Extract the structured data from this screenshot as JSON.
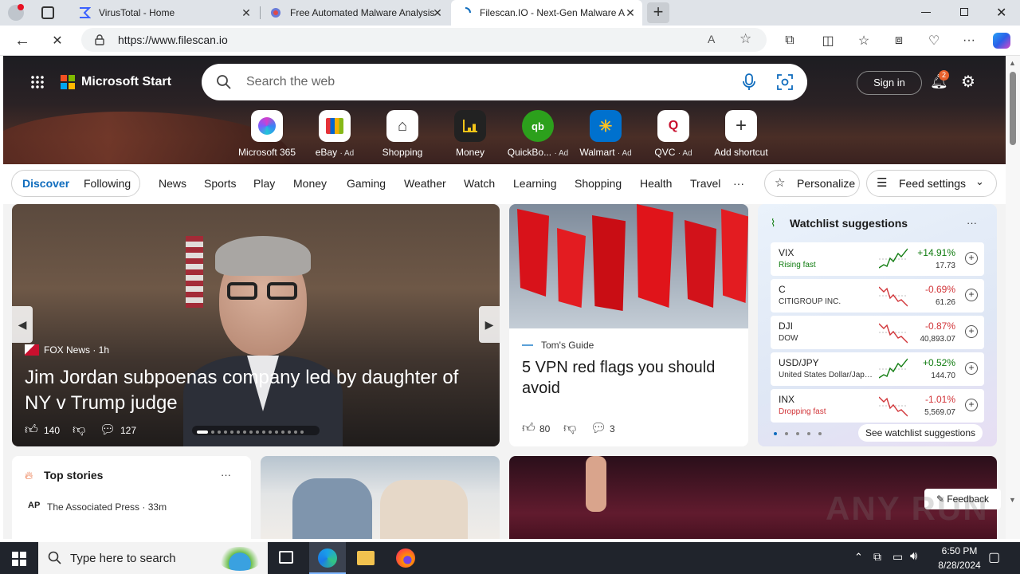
{
  "browser": {
    "tabs": [
      {
        "title": "VirusTotal - Home"
      },
      {
        "title": "Free Automated Malware Analysis"
      },
      {
        "title": "Filescan.IO - Next-Gen Malware A"
      }
    ],
    "new_tab": "+",
    "url": "https://www.filescan.io"
  },
  "msn": {
    "brand": "Microsoft Start",
    "search_placeholder": "Search the web",
    "sign_in": "Sign in",
    "notif_count": "2",
    "shortcuts": [
      {
        "label": "Microsoft 365",
        "ad": ""
      },
      {
        "label": "eBay",
        "ad": "· Ad"
      },
      {
        "label": "Shopping",
        "ad": ""
      },
      {
        "label": "Money",
        "ad": ""
      },
      {
        "label": "QuickBo...",
        "ad": "· Ad"
      },
      {
        "label": "Walmart",
        "ad": "· Ad"
      },
      {
        "label": "QVC",
        "ad": "· Ad"
      },
      {
        "label": "Add shortcut",
        "ad": ""
      }
    ],
    "feed_tabs": {
      "discover": "Discover",
      "following": "Following"
    },
    "nav": [
      "News",
      "Sports",
      "Play",
      "Money",
      "Gaming",
      "Weather",
      "Watch",
      "Learning",
      "Shopping",
      "Health",
      "Travel"
    ],
    "more": "···",
    "personalize": "Personalize",
    "feed_settings": "Feed settings",
    "hero_story": {
      "source": "FOX News · 1h",
      "headline": "Jim Jordan subpoenas company led by daughter of NY v Trump judge",
      "likes": "140",
      "comments": "127"
    },
    "story2": {
      "source": "Tom's Guide",
      "headline": "5 VPN red flags you should avoid",
      "likes": "80",
      "comments": "3"
    },
    "watchlist": {
      "title": "Watchlist suggestions",
      "more": "···",
      "see_all": "See watchlist suggestions",
      "rows": [
        {
          "symbol": "VIX",
          "name": "Rising fast",
          "change": "+14.91%",
          "value": "17.73",
          "up": true
        },
        {
          "symbol": "C",
          "name": "CITIGROUP INC.",
          "change": "-0.69%",
          "value": "61.26",
          "up": false
        },
        {
          "symbol": "DJI",
          "name": "DOW",
          "change": "-0.87%",
          "value": "40,893.07",
          "up": false
        },
        {
          "symbol": "USD/JPY",
          "name": "United States Dollar/Japa...",
          "change": "+0.52%",
          "value": "144.70",
          "up": true
        },
        {
          "symbol": "INX",
          "name": "Dropping fast",
          "change": "-1.01%",
          "value": "5,569.07",
          "up": false
        }
      ]
    },
    "top_stories": {
      "title": "Top stories",
      "more": "···",
      "first_source": "The Associated Press · 33m"
    },
    "feedback": "Feedback"
  },
  "watermark": "ANY RUN",
  "taskbar": {
    "search_placeholder": "Type here to search",
    "time": "6:50 PM",
    "date": "8/28/2024"
  },
  "colors": {
    "accent": "#0f6cbd",
    "negative": "#d13438",
    "positive": "#107c10"
  }
}
